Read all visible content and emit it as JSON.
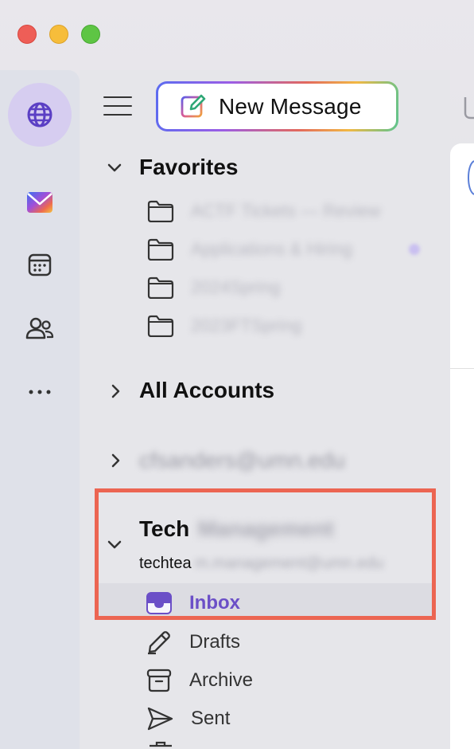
{
  "window": {
    "controls": [
      "close",
      "minimize",
      "zoom"
    ]
  },
  "rail": {
    "items": [
      {
        "name": "globe-icon",
        "active": true
      },
      {
        "name": "mail-icon",
        "active": false
      },
      {
        "name": "calendar-icon",
        "active": false
      },
      {
        "name": "people-icon",
        "active": false
      },
      {
        "name": "more-icon",
        "active": false
      }
    ]
  },
  "toolbar": {
    "new_message_label": "New Message"
  },
  "favorites": {
    "title": "Favorites",
    "folders": [
      "ACTF Tickets — Review",
      "Applications & Hiring",
      "2024Spring",
      "2023FTSpring"
    ]
  },
  "all_accounts": {
    "title": "All Accounts"
  },
  "account1": {
    "email": "cfsanders@umn.edu"
  },
  "account2": {
    "name_visible": "Tech",
    "name_hidden": "Management",
    "email_visible": "techtea",
    "email_hidden": "m.management@umn.edu"
  },
  "nav": {
    "inbox": "Inbox",
    "drafts": "Drafts",
    "archive": "Archive",
    "sent": "Sent"
  },
  "colors": {
    "accent": "#6b4fc7",
    "highlight_border": "#ec6552"
  }
}
